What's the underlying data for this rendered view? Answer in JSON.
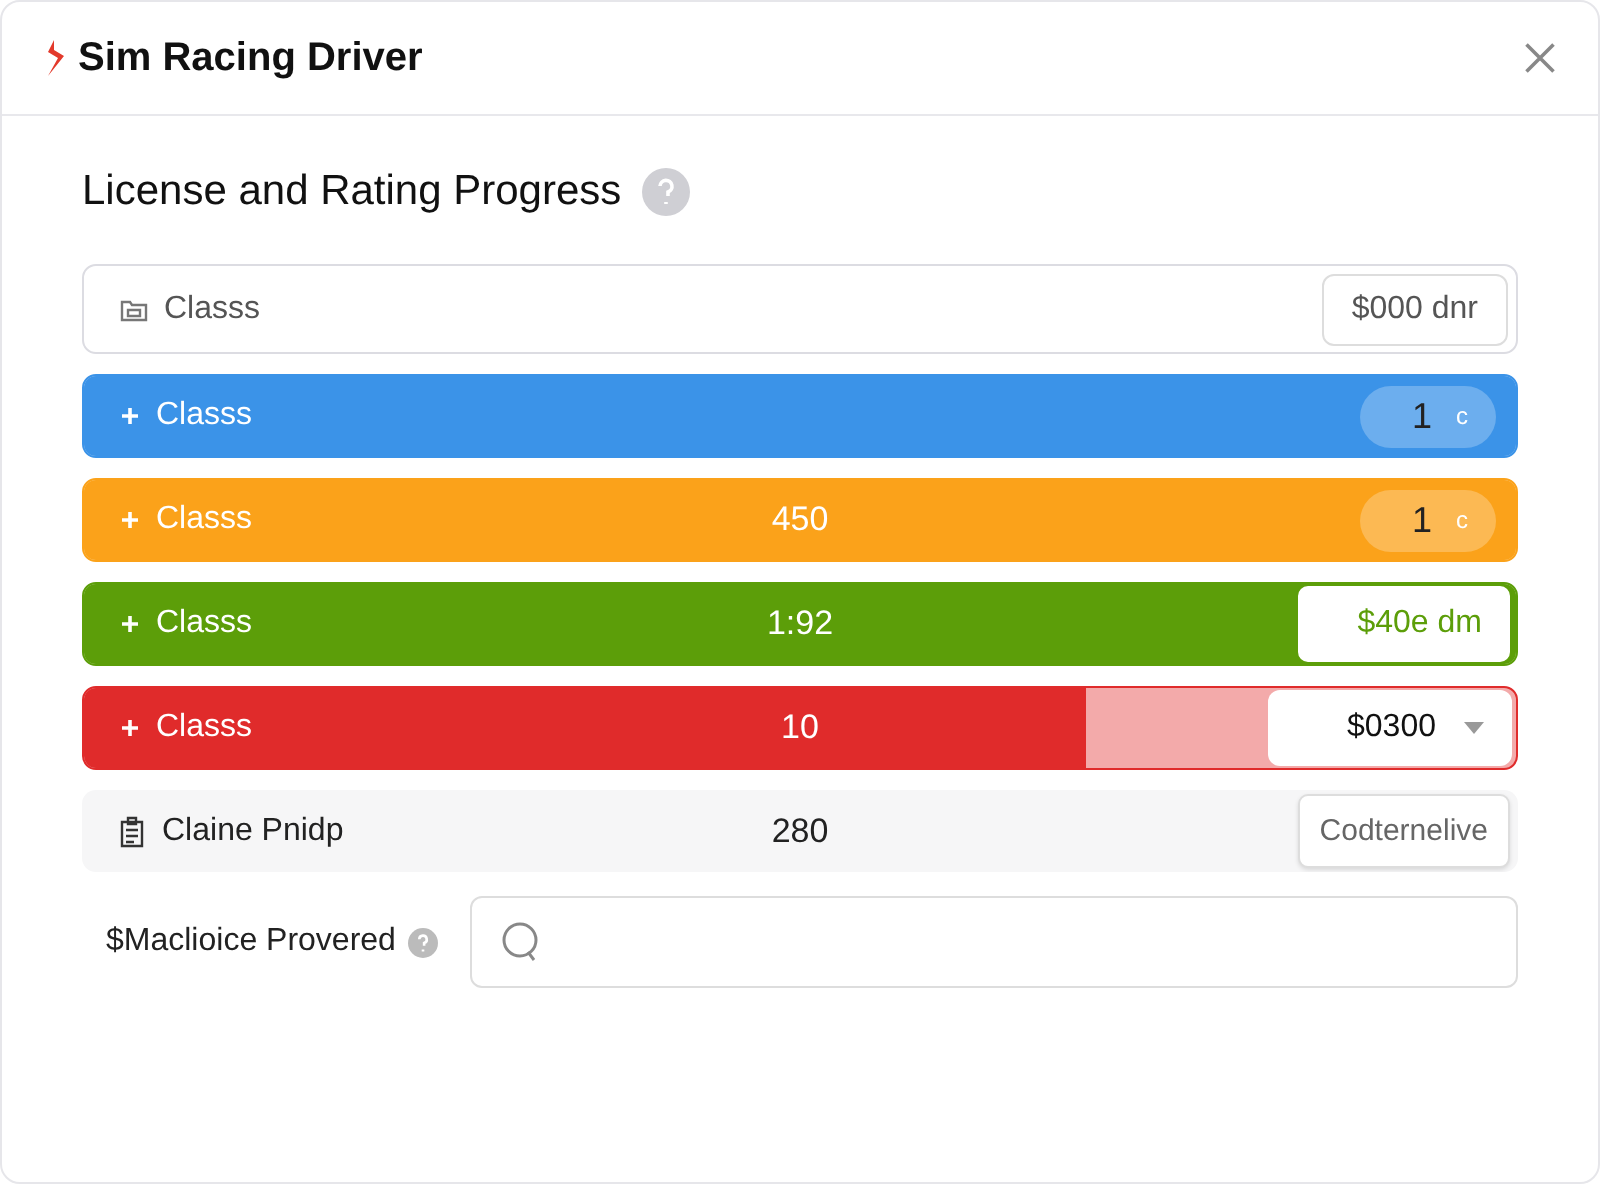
{
  "window": {
    "title": "Sim Racing Driver"
  },
  "heading": "License and Rating Progress",
  "rows": [
    {
      "kind": "header",
      "label": "Classs",
      "value": "$000 dnr"
    },
    {
      "kind": "bar",
      "label": "Classs",
      "color": "#3b93e8",
      "level": 1,
      "badge": "1",
      "badge_unit": "c"
    },
    {
      "kind": "bar",
      "label": "Classs",
      "color": "#fba21a",
      "level": 1,
      "reading": "450",
      "badge": "1",
      "badge_unit": "c"
    },
    {
      "kind": "bar",
      "label": "Classs",
      "color": "#5c9e09",
      "level": 1,
      "reading": "1:92",
      "value": "$40e dm"
    },
    {
      "kind": "bar",
      "label": "Classs",
      "color": "#e02b2b",
      "level": 0.7,
      "reading": "10",
      "dropdown": "$0300"
    },
    {
      "kind": "plain",
      "label": "Claine Pnidp",
      "reading": "280",
      "button": "Codternelive"
    }
  ],
  "field": {
    "label": "$Maclioice Provered"
  }
}
